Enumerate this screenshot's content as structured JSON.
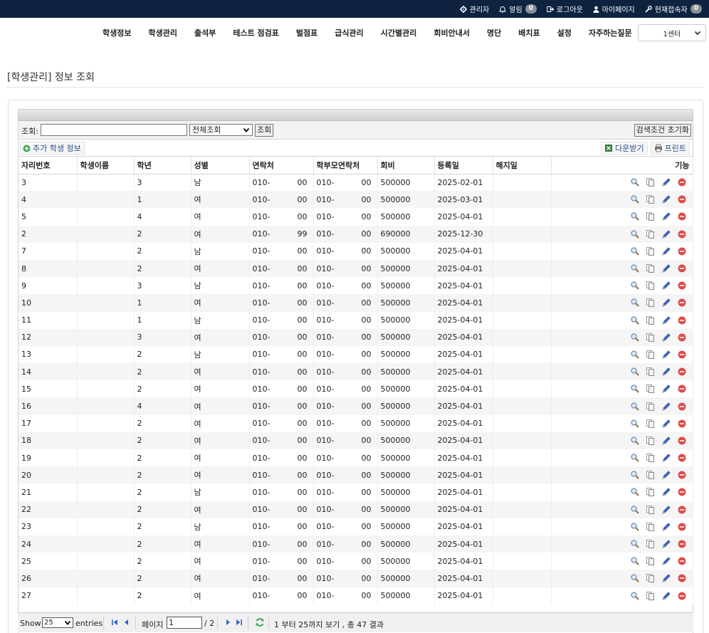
{
  "topbar": {
    "admin": "관리자",
    "alerts": "알림",
    "alerts_count": "0",
    "logout": "로그아웃",
    "mypage": "마이페이지",
    "online": "현재접속자",
    "online_count": "0"
  },
  "nav": {
    "items": [
      "학생정보",
      "학생관리",
      "출석부",
      "테스트 점검표",
      "벌점표",
      "급식관리",
      "시간별관리",
      "회비안내서",
      "명단",
      "배치표",
      "설정",
      "자주하는질문"
    ],
    "center": "1센터"
  },
  "page_title": "[학생관리] 정보 조회",
  "search": {
    "label": "조회:",
    "value": "",
    "filter": "전체조회",
    "search_button": "조회",
    "reset_button": "검색조건 초기화"
  },
  "toolbar": {
    "add": "추가 학생 정보",
    "download": "다운받기",
    "print": "프린트"
  },
  "columns": [
    "자리번호",
    "학생이름",
    "학년",
    "성별",
    "연락처",
    "학부모연락처",
    "회비",
    "등록일",
    "해지일",
    "기능"
  ],
  "rows": [
    {
      "seat": "3",
      "name": "",
      "grade": "3",
      "gender": "남",
      "phone_a": "010-",
      "phone_b": "00",
      "parent_a": "010-",
      "parent_b": "00",
      "fee": "500000",
      "reg": "2025-02-01",
      "end": ""
    },
    {
      "seat": "4",
      "name": "",
      "grade": "1",
      "gender": "여",
      "phone_a": "010-",
      "phone_b": "00",
      "parent_a": "010-",
      "parent_b": "00",
      "fee": "500000",
      "reg": "2025-03-01",
      "end": ""
    },
    {
      "seat": "5",
      "name": "",
      "grade": "4",
      "gender": "여",
      "phone_a": "010-",
      "phone_b": "00",
      "parent_a": "010-",
      "parent_b": "00",
      "fee": "500000",
      "reg": "2025-04-01",
      "end": ""
    },
    {
      "seat": "2",
      "name": "",
      "grade": "2",
      "gender": "여",
      "phone_a": "010-",
      "phone_b": "99",
      "parent_a": "010-",
      "parent_b": "00",
      "fee": "690000",
      "reg": "2025-12-30",
      "end": ""
    },
    {
      "seat": "7",
      "name": "",
      "grade": "2",
      "gender": "남",
      "phone_a": "010-",
      "phone_b": "00",
      "parent_a": "010-",
      "parent_b": "00",
      "fee": "500000",
      "reg": "2025-04-01",
      "end": ""
    },
    {
      "seat": "8",
      "name": "",
      "grade": "2",
      "gender": "여",
      "phone_a": "010-",
      "phone_b": "00",
      "parent_a": "010-",
      "parent_b": "00",
      "fee": "500000",
      "reg": "2025-04-01",
      "end": ""
    },
    {
      "seat": "9",
      "name": "",
      "grade": "3",
      "gender": "남",
      "phone_a": "010-",
      "phone_b": "00",
      "parent_a": "010-",
      "parent_b": "00",
      "fee": "500000",
      "reg": "2025-04-01",
      "end": ""
    },
    {
      "seat": "10",
      "name": "",
      "grade": "1",
      "gender": "여",
      "phone_a": "010-",
      "phone_b": "00",
      "parent_a": "010-",
      "parent_b": "00",
      "fee": "500000",
      "reg": "2025-04-01",
      "end": ""
    },
    {
      "seat": "11",
      "name": "",
      "grade": "1",
      "gender": "남",
      "phone_a": "010-",
      "phone_b": "00",
      "parent_a": "010-",
      "parent_b": "00",
      "fee": "500000",
      "reg": "2025-04-01",
      "end": ""
    },
    {
      "seat": "12",
      "name": "",
      "grade": "3",
      "gender": "여",
      "phone_a": "010-",
      "phone_b": "00",
      "parent_a": "010-",
      "parent_b": "00",
      "fee": "500000",
      "reg": "2025-04-01",
      "end": ""
    },
    {
      "seat": "13",
      "name": "",
      "grade": "2",
      "gender": "남",
      "phone_a": "010-",
      "phone_b": "00",
      "parent_a": "010-",
      "parent_b": "00",
      "fee": "500000",
      "reg": "2025-04-01",
      "end": ""
    },
    {
      "seat": "14",
      "name": "",
      "grade": "2",
      "gender": "여",
      "phone_a": "010-",
      "phone_b": "00",
      "parent_a": "010-",
      "parent_b": "00",
      "fee": "500000",
      "reg": "2025-04-01",
      "end": ""
    },
    {
      "seat": "15",
      "name": "",
      "grade": "2",
      "gender": "여",
      "phone_a": "010-",
      "phone_b": "00",
      "parent_a": "010-",
      "parent_b": "00",
      "fee": "500000",
      "reg": "2025-04-01",
      "end": ""
    },
    {
      "seat": "16",
      "name": "",
      "grade": "4",
      "gender": "여",
      "phone_a": "010-",
      "phone_b": "00",
      "parent_a": "010-",
      "parent_b": "00",
      "fee": "500000",
      "reg": "2025-04-01",
      "end": ""
    },
    {
      "seat": "17",
      "name": "",
      "grade": "2",
      "gender": "여",
      "phone_a": "010-",
      "phone_b": "00",
      "parent_a": "010-",
      "parent_b": "00",
      "fee": "500000",
      "reg": "2025-04-01",
      "end": ""
    },
    {
      "seat": "18",
      "name": "",
      "grade": "2",
      "gender": "여",
      "phone_a": "010-",
      "phone_b": "00",
      "parent_a": "010-",
      "parent_b": "00",
      "fee": "500000",
      "reg": "2025-04-01",
      "end": ""
    },
    {
      "seat": "19",
      "name": "",
      "grade": "2",
      "gender": "여",
      "phone_a": "010-",
      "phone_b": "00",
      "parent_a": "010-",
      "parent_b": "00",
      "fee": "500000",
      "reg": "2025-04-01",
      "end": ""
    },
    {
      "seat": "20",
      "name": "",
      "grade": "2",
      "gender": "여",
      "phone_a": "010-",
      "phone_b": "00",
      "parent_a": "010-",
      "parent_b": "00",
      "fee": "500000",
      "reg": "2025-04-01",
      "end": ""
    },
    {
      "seat": "21",
      "name": "",
      "grade": "2",
      "gender": "남",
      "phone_a": "010-",
      "phone_b": "00",
      "parent_a": "010-",
      "parent_b": "00",
      "fee": "500000",
      "reg": "2025-04-01",
      "end": ""
    },
    {
      "seat": "22",
      "name": "",
      "grade": "2",
      "gender": "여",
      "phone_a": "010-",
      "phone_b": "00",
      "parent_a": "010-",
      "parent_b": "00",
      "fee": "500000",
      "reg": "2025-04-01",
      "end": ""
    },
    {
      "seat": "23",
      "name": "",
      "grade": "2",
      "gender": "남",
      "phone_a": "010-",
      "phone_b": "00",
      "parent_a": "010-",
      "parent_b": "00",
      "fee": "500000",
      "reg": "2025-04-01",
      "end": ""
    },
    {
      "seat": "24",
      "name": "",
      "grade": "2",
      "gender": "여",
      "phone_a": "010-",
      "phone_b": "00",
      "parent_a": "010-",
      "parent_b": "00",
      "fee": "500000",
      "reg": "2025-04-01",
      "end": ""
    },
    {
      "seat": "25",
      "name": "",
      "grade": "2",
      "gender": "여",
      "phone_a": "010-",
      "phone_b": "00",
      "parent_a": "010-",
      "parent_b": "00",
      "fee": "500000",
      "reg": "2025-04-01",
      "end": ""
    },
    {
      "seat": "26",
      "name": "",
      "grade": "2",
      "gender": "여",
      "phone_a": "010-",
      "phone_b": "00",
      "parent_a": "010-",
      "parent_b": "00",
      "fee": "500000",
      "reg": "2025-04-01",
      "end": ""
    },
    {
      "seat": "27",
      "name": "",
      "grade": "2",
      "gender": "여",
      "phone_a": "010-",
      "phone_b": "00",
      "parent_a": "010-",
      "parent_b": "00",
      "fee": "500000",
      "reg": "2025-04-01",
      "end": ""
    }
  ],
  "row_icons": [
    "magnifier-icon",
    "copy-icon",
    "pencil-icon",
    "delete-icon"
  ],
  "pager": {
    "show": "Show",
    "entries_value": "25",
    "entries": "entries",
    "page_label": "페이지",
    "page_value": "1",
    "page_total": "/ 2",
    "summary": "1 부터 25까지 보기 , 총 47 결과"
  },
  "colors": {
    "topbar": "#0d2340",
    "link": "#2a4a8a",
    "delete": "#e04a4a",
    "add": "#3aa657"
  }
}
